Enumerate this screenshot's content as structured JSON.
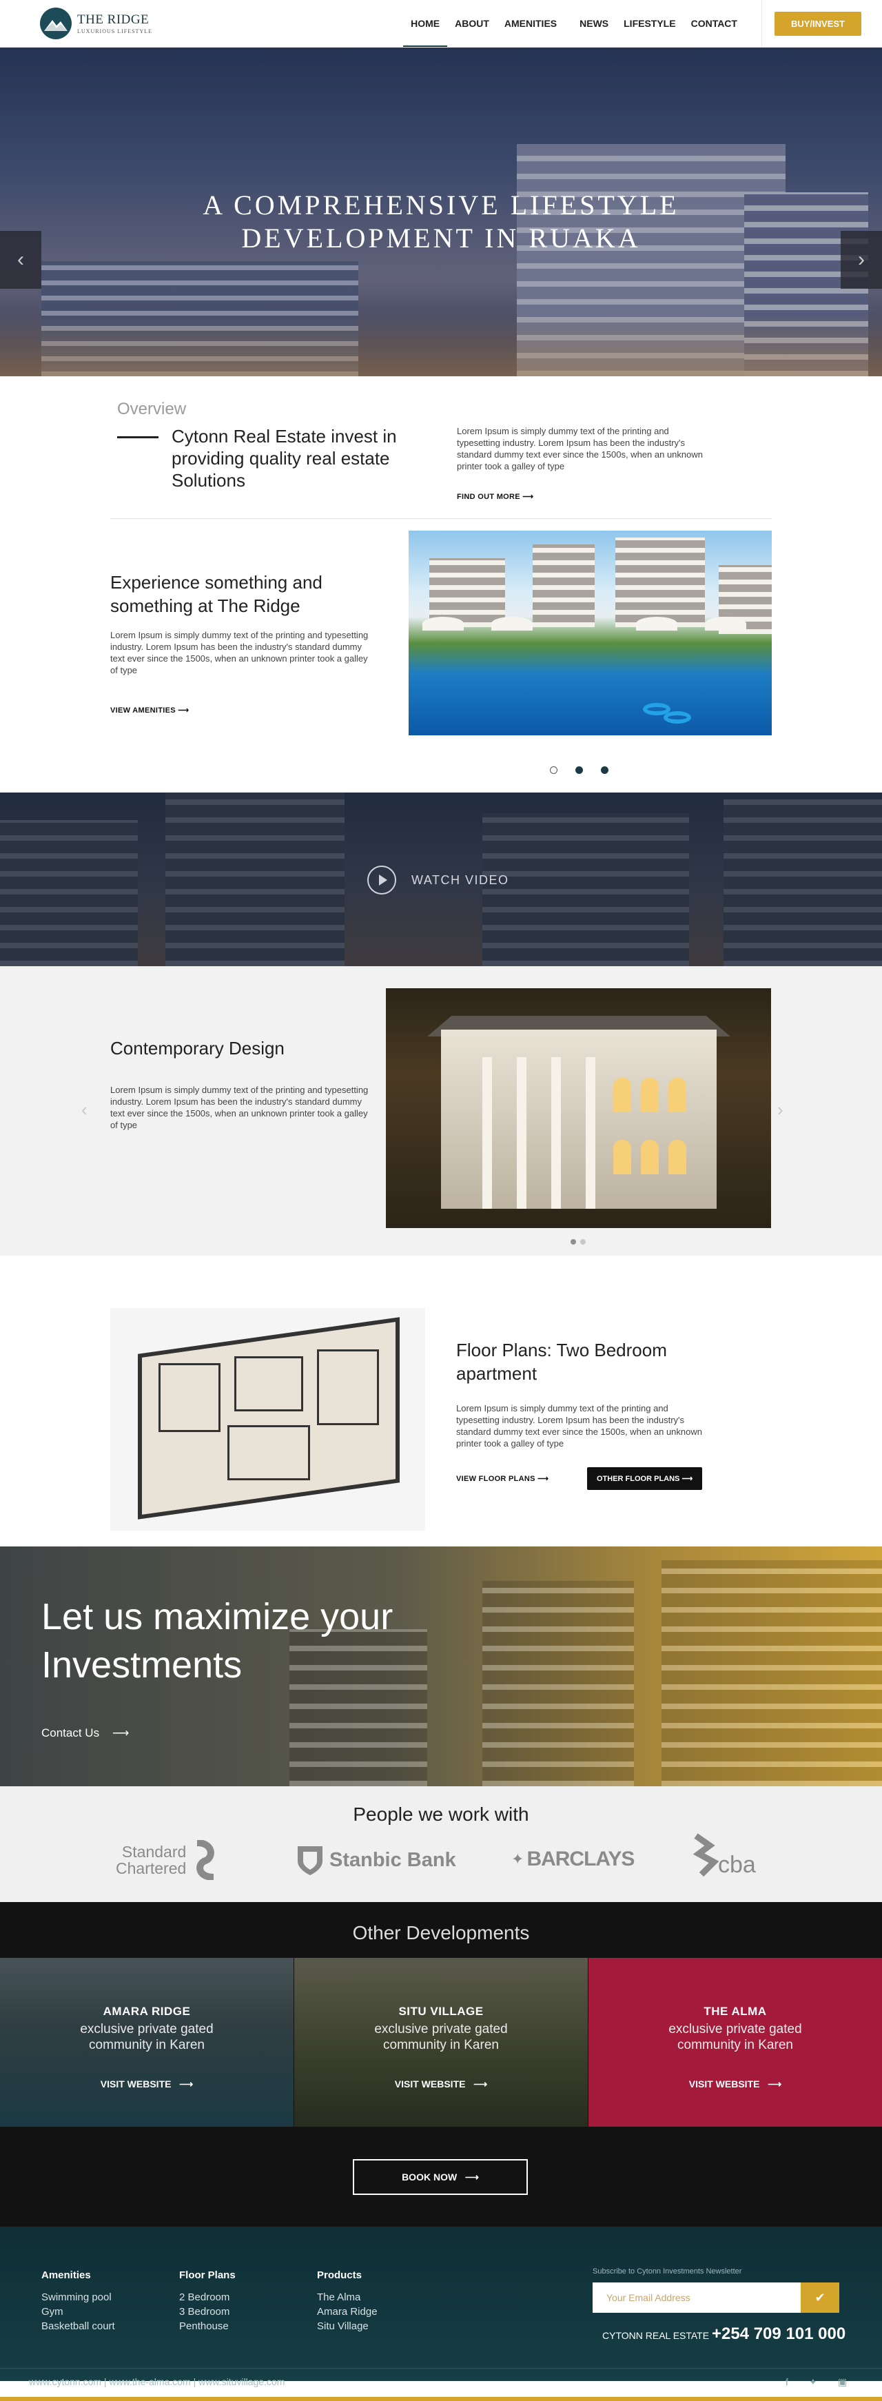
{
  "nav": {
    "logo_title": "THE RIDGE",
    "logo_subtitle": "LUXURIOUS LIFESTYLE",
    "items": [
      "HOME",
      "ABOUT",
      "AMENITIES",
      "NEWS",
      "LIFESTYLE",
      "CONTACT"
    ],
    "active": "HOME",
    "cta": "BUY/INVEST",
    "colors": {
      "accent": "#d5a42a",
      "brand": "#1d3b44"
    }
  },
  "hero": {
    "title": "A COMPREHENSIVE LIFESTYLE DEVELOPMENT IN RUAKA",
    "prev_icon": "chevron-left-icon",
    "next_icon": "chevron-right-icon"
  },
  "overview": {
    "label": "Overview",
    "heading": "Cytonn Real Estate invest in providing quality real estate Solutions",
    "text": "Lorem Ipsum is simply dummy text of the printing and typesetting industry. Lorem Ipsum has been the industry's standard dummy text ever since the 1500s, when an unknown printer took a galley of type",
    "link": "FIND OUT MORE"
  },
  "experience": {
    "heading": "Experience something and something at The Ridge",
    "text": "Lorem Ipsum is simply dummy text of the printing and typesetting industry. Lorem Ipsum has been the industry's standard dummy text ever since the 1500s, when an unknown printer took a galley of type",
    "link": "VIEW AMENITIES"
  },
  "video": {
    "label": "WATCH VIDEO"
  },
  "design": {
    "heading": "Contemporary Design",
    "text": "Lorem Ipsum is simply dummy text of the printing and typesetting industry. Lorem Ipsum has been the industry's standard dummy text ever since the 1500s, when an unknown printer took a galley of type"
  },
  "floor": {
    "heading": "Floor Plans: Two Bedroom apartment",
    "text": "Lorem Ipsum is simply dummy text of the printing and typesetting industry. Lorem Ipsum has been the industry's standard dummy text ever since the 1500s, when an unknown printer took a galley of type",
    "link": "VIEW FLOOR PLANS",
    "button": "OTHER FLOOR PLANS"
  },
  "invest": {
    "heading": "Let us maximize your Investments",
    "link": "Contact Us"
  },
  "partners": {
    "heading": "People we work with",
    "sc_1": "Standard",
    "sc_2": "Chartered",
    "stanbic": "Stanbic Bank",
    "barclays": "BARCLAYS",
    "cba": "cba"
  },
  "developments": {
    "heading": "Other Developments",
    "cards": [
      {
        "name": "AMARA RIDGE",
        "desc": "exclusive private gated community in Karen",
        "link": "VISIT WEBSITE"
      },
      {
        "name": "SITU VILLAGE",
        "desc": "exclusive private gated community in Karen",
        "link": "VISIT WEBSITE"
      },
      {
        "name": "THE ALMA",
        "desc": "exclusive private gated community in Karen",
        "link": "VISIT WEBSITE"
      }
    ],
    "book": "BOOK NOW",
    "highlight_color": "#a31a3b"
  },
  "footer": {
    "cols": [
      {
        "title": "Amenities",
        "items": [
          "Swimming pool",
          "Gym",
          "Basketball court"
        ]
      },
      {
        "title": "Floor Plans",
        "items": [
          "2 Bedroom",
          "3 Bedroom",
          "Penthouse"
        ]
      },
      {
        "title": "Products",
        "items": [
          "The Alma",
          "Amara Ridge",
          "Situ Village"
        ]
      }
    ],
    "newsletter_label": "Subscribe to Cytonn Investments Newsletter",
    "newsletter_placeholder": "Your Email Address",
    "phone_label": "CYTONN REAL ESTATE",
    "phone": "+254 709 101 000",
    "links": "www.cytonn.com | www.the-alma.com | www.situvillage.com",
    "social": [
      "facebook-icon",
      "twitter-icon",
      "instagram-icon"
    ]
  }
}
